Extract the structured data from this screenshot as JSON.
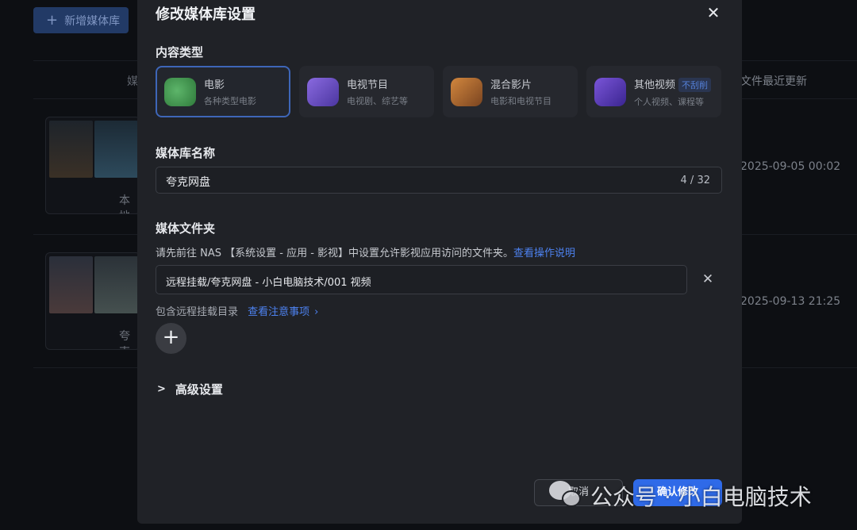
{
  "background": {
    "add_library_label": "新增媒体库",
    "col_left_fragment": "媒",
    "col_right_header": "文件最近更新",
    "rows": [
      {
        "label_fragment": "本地",
        "date": "2025-09-05 00:02"
      },
      {
        "label_fragment": "夸克",
        "date": "2025-09-13 21:25"
      }
    ]
  },
  "modal": {
    "title": "修改媒体库设置",
    "content_type": {
      "label": "内容类型",
      "options": [
        {
          "title": "电影",
          "subtitle": "各种类型电影",
          "selected": true,
          "icon": "movie-icon",
          "color": "#3f8f4a"
        },
        {
          "title": "电视节目",
          "subtitle": "电视剧、综艺等",
          "selected": false,
          "icon": "tv-icon",
          "color": "#6a4fb8"
        },
        {
          "title": "混合影片",
          "subtitle": "电影和电视节目",
          "selected": false,
          "icon": "camera-icon",
          "color": "#b86a2e"
        },
        {
          "title": "其他视频",
          "tag": "不刮削",
          "subtitle": "个人视频、课程等",
          "selected": false,
          "icon": "folder-icon",
          "color": "#5b3db0"
        }
      ]
    },
    "library_name": {
      "label": "媒体库名称",
      "value": "夸克网盘",
      "counter": "4 / 32"
    },
    "media_folder": {
      "label": "媒体文件夹",
      "hint": "请先前往 NAS 【系统设置 - 应用 - 影视】中设置允许影视应用访问的文件夹。",
      "hint_link": "查看操作说明",
      "path_value": "远程挂载/夸克网盘 - 小白电脑技术/001 视频",
      "remote_text": "包含远程挂载目录",
      "remote_link": "查看注意事项"
    },
    "advanced_label": "高级设置",
    "cancel_label": "取消",
    "confirm_label": "确认修改"
  },
  "watermark": {
    "text": "公众号 · 小白电脑技术"
  }
}
